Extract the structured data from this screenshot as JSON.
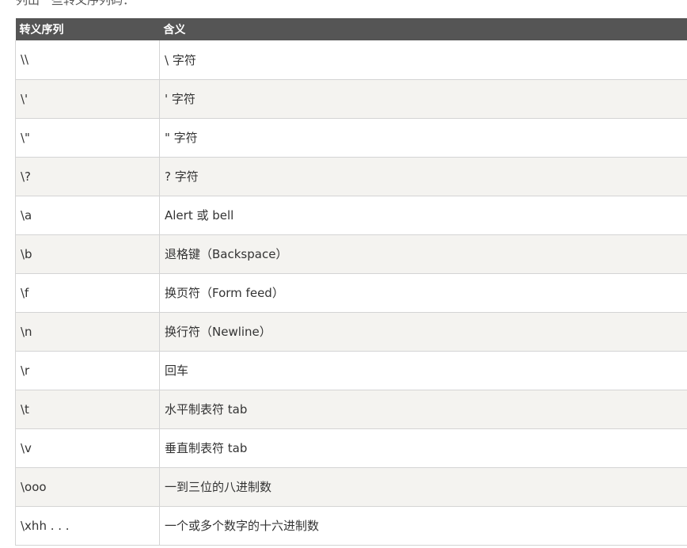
{
  "intro_text": "列出一些转义序列码：",
  "table": {
    "headers": [
      "转义序列",
      "含义"
    ],
    "rows": [
      {
        "seq": "\\\\",
        "meaning": "\\ 字符"
      },
      {
        "seq": "\\'",
        "meaning": "' 字符"
      },
      {
        "seq": "\\\"",
        "meaning": "\" 字符"
      },
      {
        "seq": "\\?",
        "meaning": "? 字符"
      },
      {
        "seq": "\\a",
        "meaning": "Alert 或 bell"
      },
      {
        "seq": "\\b",
        "meaning": "退格键（Backspace）"
      },
      {
        "seq": "\\f",
        "meaning": "换页符（Form feed）"
      },
      {
        "seq": "\\n",
        "meaning": "换行符（Newline）"
      },
      {
        "seq": "\\r",
        "meaning": "回车"
      },
      {
        "seq": "\\t",
        "meaning": "水平制表符 tab"
      },
      {
        "seq": "\\v",
        "meaning": "垂直制表符 tab"
      },
      {
        "seq": "\\ooo",
        "meaning": "一到三位的八进制数"
      },
      {
        "seq": "\\xhh . . .",
        "meaning": "一个或多个数字的十六进制数"
      }
    ]
  }
}
